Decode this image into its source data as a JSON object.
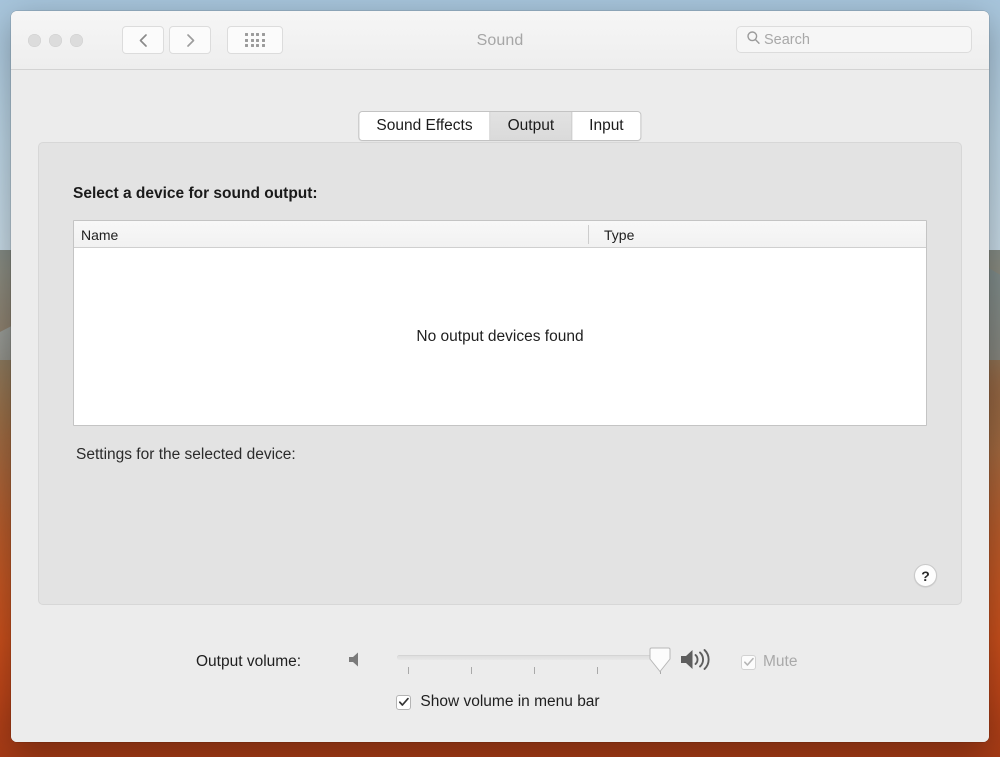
{
  "window": {
    "title": "Sound",
    "traffic_lights": [
      "close",
      "minimize",
      "zoom"
    ],
    "nav": {
      "back_icon": "chevron-left-icon",
      "forward_icon": "chevron-right-icon",
      "grid_icon": "show-all-grid-icon"
    },
    "search": {
      "placeholder": "Search",
      "value": "",
      "icon": "search-icon"
    }
  },
  "tabs": [
    {
      "label": "Sound Effects",
      "selected": false
    },
    {
      "label": "Output",
      "selected": true
    },
    {
      "label": "Input",
      "selected": false
    }
  ],
  "panel": {
    "select_device_label": "Select a device for sound output:",
    "table": {
      "columns": [
        "Name",
        "Type"
      ],
      "rows": [],
      "empty_message": "No output devices found"
    },
    "settings_label": "Settings for the selected device:",
    "help_button_label": "?"
  },
  "volume": {
    "label": "Output volume:",
    "low_icon": "speaker-low-icon",
    "high_icon": "speaker-high-icon",
    "slider": {
      "value": 100,
      "min": 0,
      "max": 100,
      "tick_count": 5
    },
    "mute": {
      "label": "Mute",
      "checked": true,
      "disabled": true
    }
  },
  "menu_bar_option": {
    "label": "Show volume in menu bar",
    "checked": true,
    "disabled": false
  },
  "colors": {
    "window_bg": "#ececec",
    "panel_bg": "#e3e3e3",
    "table_bg": "#ffffff",
    "tab_selected_bg": "#dfdfdf",
    "title_text": "#a6a6a6",
    "disabled_text": "#a9a9a9"
  }
}
